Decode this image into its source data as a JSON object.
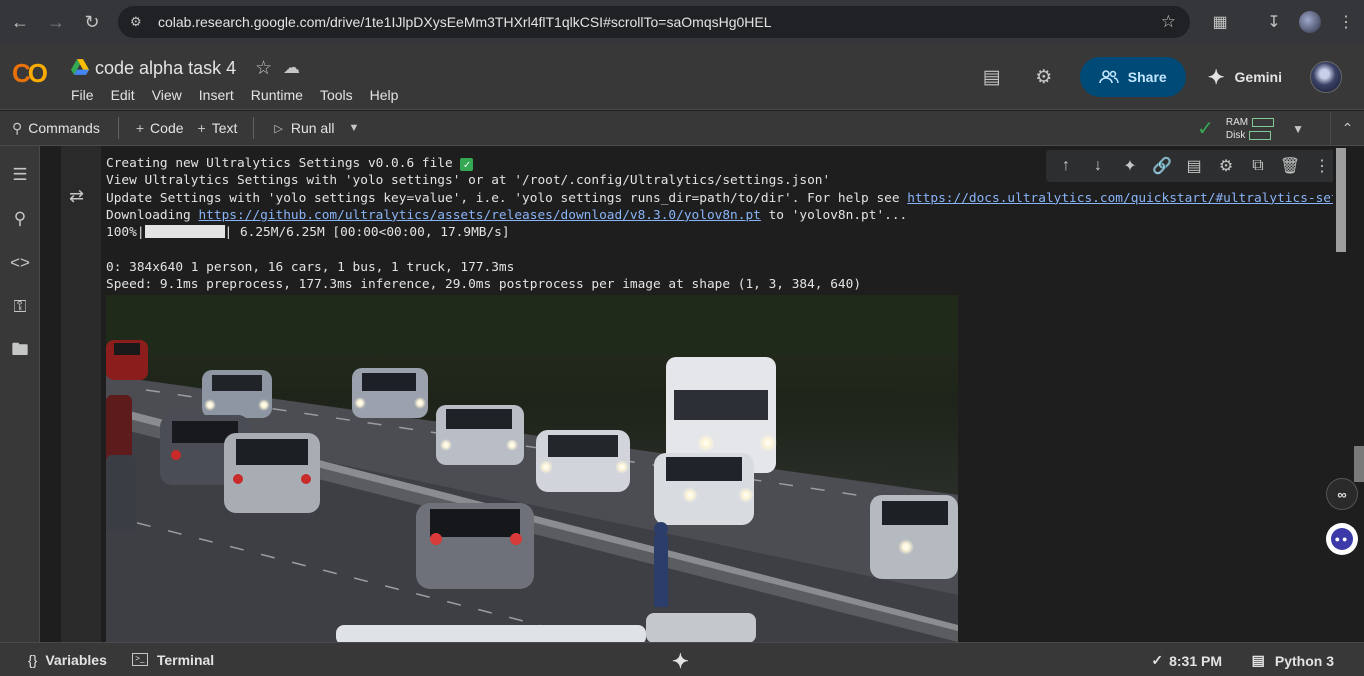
{
  "browser": {
    "url": "colab.research.google.com/drive/1te1IJlpDXysEeMm3THXrl4flT1qlkCSI#scrollTo=saOmqsHg0HEL"
  },
  "header": {
    "logo": "CO",
    "notebook_title": "code alpha task 4",
    "menu": [
      "File",
      "Edit",
      "View",
      "Insert",
      "Runtime",
      "Tools",
      "Help"
    ],
    "share_label": "Share",
    "gemini_label": "Gemini"
  },
  "toolbar": {
    "commands_label": "Commands",
    "code_label": "Code",
    "text_label": "Text",
    "run_all_label": "Run all",
    "ram_label": "RAM",
    "disk_label": "Disk"
  },
  "output": {
    "line1": "Creating new Ultralytics Settings v0.0.6 file ",
    "line2": "View Ultralytics Settings with 'yolo settings' or at '/root/.config/Ultralytics/settings.json'",
    "line3_pre": "Update Settings with 'yolo settings key=value', i.e. 'yolo settings runs_dir=path/to/dir'. For help see ",
    "line3_link": "https://docs.ultralytics.com/quickstart/#ultralytics-settings",
    "line4_pre": "Downloading ",
    "line4_link": "https://github.com/ultralytics/assets/releases/download/v8.3.0/yolov8n.pt",
    "line4_post": " to 'yolov8n.pt'...",
    "line5_pre": "100%|",
    "line5_post": "| 6.25M/6.25M [00:00<00:00, 17.9MB/s]",
    "line6": "0: 384x640 1 person, 16 cars, 1 bus, 1 truck, 177.3ms",
    "line7": "Speed: 9.1ms preprocess, 177.3ms inference, 29.0ms postprocess per image at shape (1, 3, 384, 640)",
    "progress_fraction": 1.0
  },
  "status": {
    "variables_label": "Variables",
    "terminal_label": "Terminal",
    "time": "8:31 PM",
    "runtime_label": "Python 3"
  },
  "colors": {
    "accent": "#f9ab00",
    "share_bg": "#004a77",
    "link": "#8ab4f8",
    "ok": "#34a853"
  }
}
